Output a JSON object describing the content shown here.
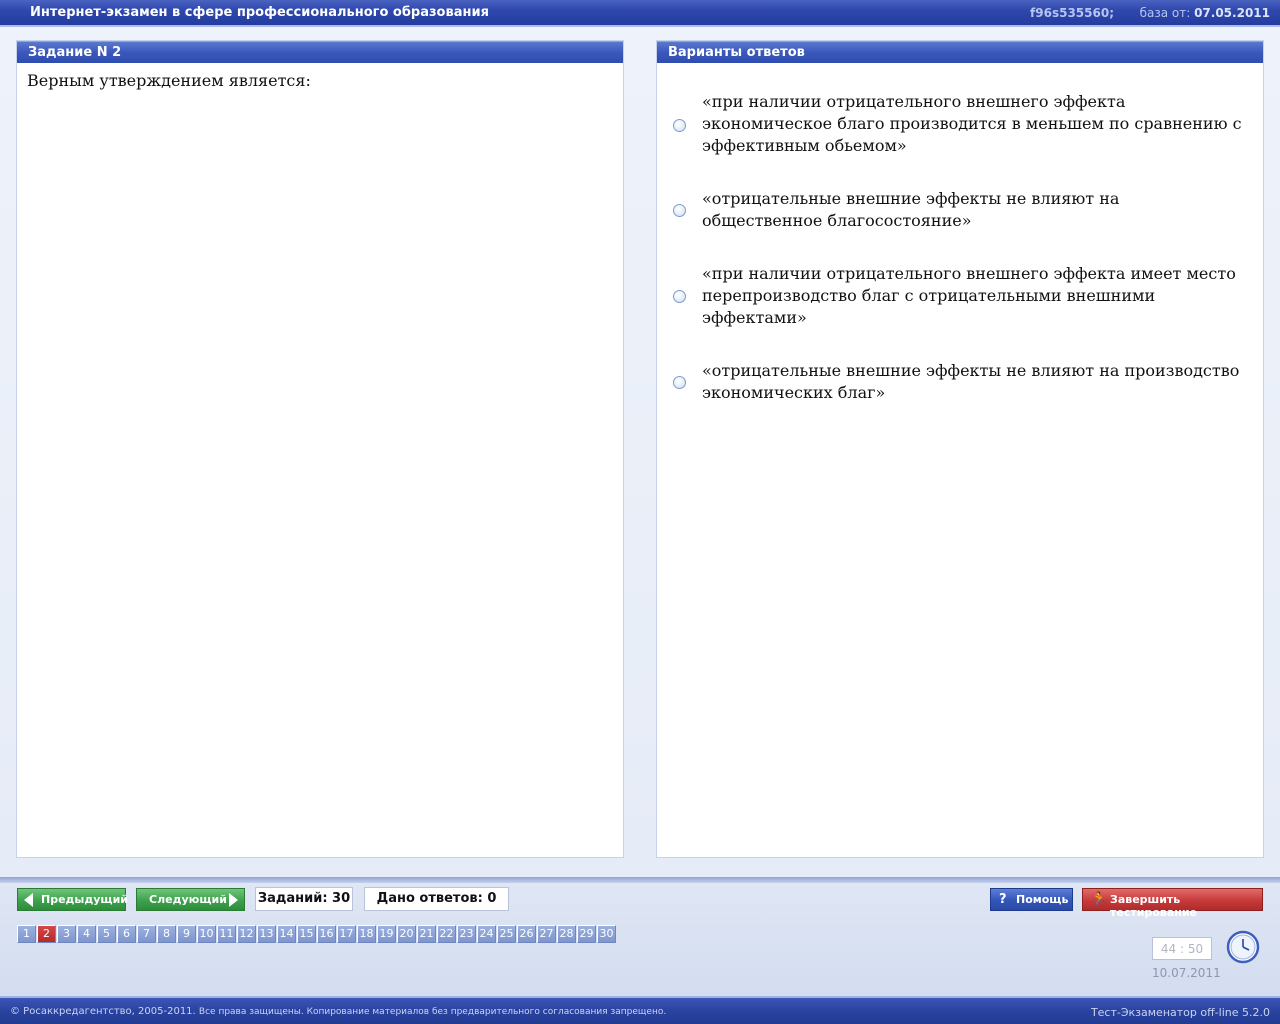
{
  "header": {
    "title": "Интернет-экзамен в сфере профессионального образования",
    "code": "f96s535560;",
    "base_label": "база от:",
    "base_date": "07.05.2011"
  },
  "question": {
    "panel_title": "Задание N 2",
    "text": "Верным утверждением является:"
  },
  "answers": {
    "panel_title": "Варианты ответов",
    "options": [
      {
        "text": "«при наличии отрицательного внешнего эффекта экономическое благо производится в меньшем по сравнению с эффективным обьемом»",
        "selected": false
      },
      {
        "text": "«отрицательные внешние эффекты не влияют на общественное благосостояние»",
        "selected": false
      },
      {
        "text": "«при наличии отрицательного внешнего эффекта имеет место перепроизводство благ с отрицательными  внешними эффектами»",
        "selected": false
      },
      {
        "text": "«отрицательные внешние эффекты не влияют на производство экономических благ»",
        "selected": false
      }
    ]
  },
  "nav": {
    "prev_label": "Предыдущий",
    "next_label": "Следующий",
    "total_label": "Заданий: 30",
    "answered_label": "Дано ответов: 0",
    "help_label": "Помощь",
    "finish_label": "Завершить тестирование",
    "current_page": 2,
    "pages": [
      "1",
      "2",
      "3",
      "4",
      "5",
      "6",
      "7",
      "8",
      "9",
      "10",
      "11",
      "12",
      "13",
      "14",
      "15",
      "16",
      "17",
      "18",
      "19",
      "20",
      "21",
      "22",
      "23",
      "24",
      "25",
      "26",
      "27",
      "28",
      "29",
      "30"
    ]
  },
  "timer": {
    "time": "44 : 50",
    "date": "10.07.2011"
  },
  "footer": {
    "copyright": "© Росаккредагентство, 2005-2011.",
    "rights": "Все права защищены. Копирование материалов без предварительного согласования запрещено.",
    "version": "Тест-Экзаменатор off-line 5.2.0"
  },
  "icons": {
    "prev": "arrow-left-icon",
    "next": "arrow-right-icon",
    "help": "question-mark-icon",
    "finish": "running-man-icon",
    "clock": "clock-icon"
  },
  "colors": {
    "titlebar": "#2f48ad",
    "current_page": "#c23434",
    "green_button": "#3ea24c",
    "finish_button": "#c73a3a",
    "help_button": "#3355b8"
  }
}
